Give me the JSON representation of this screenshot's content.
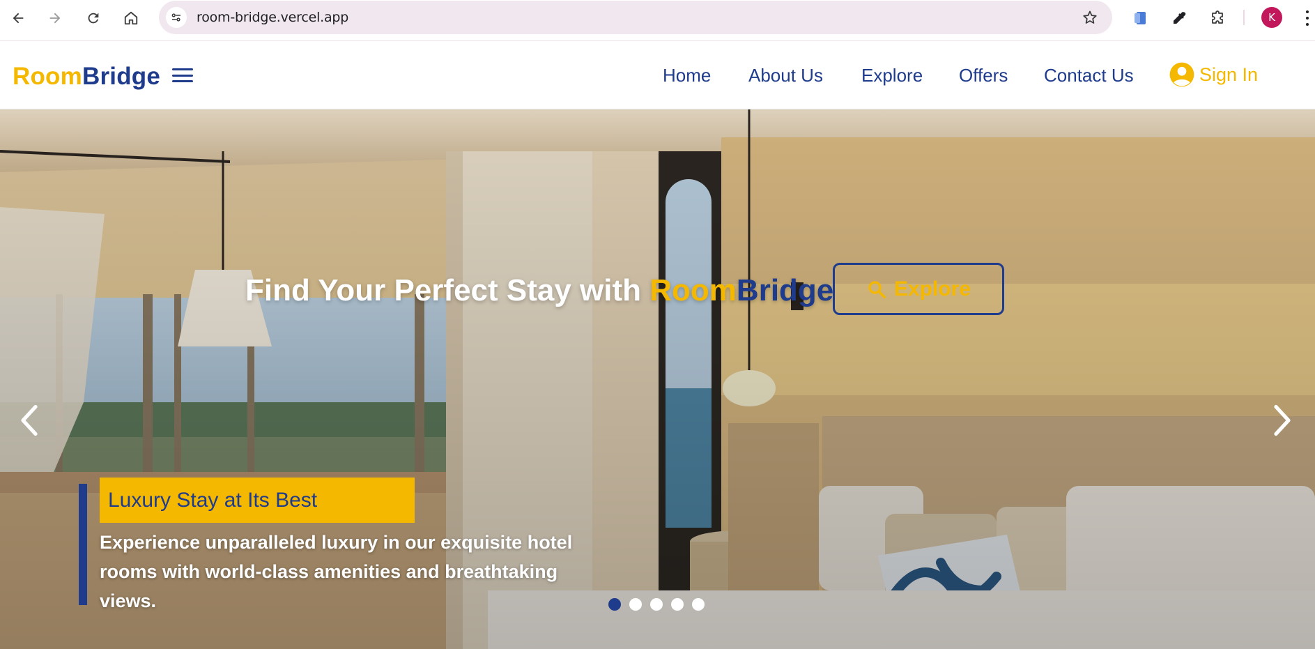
{
  "browser": {
    "url": "room-bridge.vercel.app",
    "profile_initial": "K"
  },
  "site": {
    "logo": {
      "room": "Room",
      "bridge": "Bridge"
    },
    "nav": [
      {
        "label": "Home"
      },
      {
        "label": "About Us"
      },
      {
        "label": "Explore"
      },
      {
        "label": "Offers"
      },
      {
        "label": "Contact Us"
      }
    ],
    "signin_label": "Sign In"
  },
  "hero": {
    "title_prefix": "Find Your Perfect Stay with",
    "title_room": "Room",
    "title_bridge": "Bridge",
    "explore_label": "Explore",
    "caption_title": "Luxury Stay at Its Best",
    "caption_text": "Experience unparalleled luxury in our exquisite hotel rooms with world-class amenities and breathtaking views.",
    "slides_total": 5,
    "active_slide": 1
  },
  "colors": {
    "brand_yellow": "#f5b800",
    "brand_blue": "#1f3b8c",
    "profile": "#c2185b"
  }
}
